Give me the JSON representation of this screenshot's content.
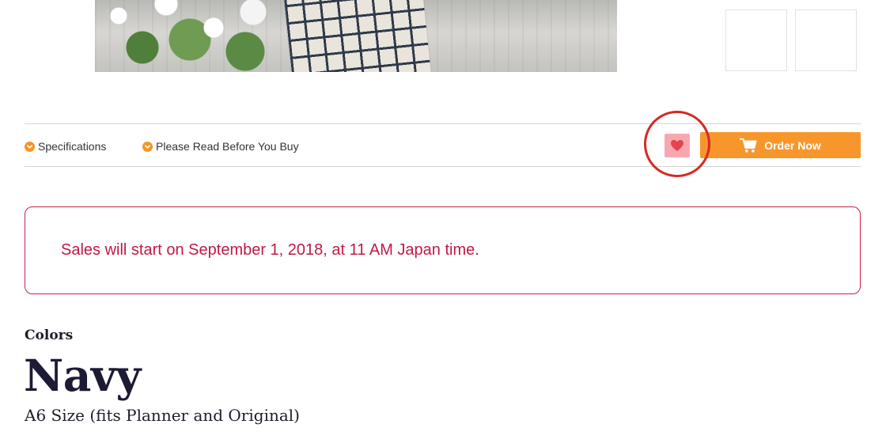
{
  "tabs": [
    {
      "label": "Specifications",
      "icon": "chevron-down-icon"
    },
    {
      "label": "Please Read Before You Buy",
      "icon": "chevron-down-icon"
    }
  ],
  "actions": {
    "favorite_icon": "heart-icon",
    "order_label": "Order Now",
    "order_icon": "cart-icon"
  },
  "notice": {
    "text": "Sales will start on September 1, 2018, at 11 AM Japan time."
  },
  "product": {
    "colors_label": "Colors",
    "color_name": "Navy",
    "size_text": "A6 Size (fits Planner and Original)"
  },
  "colors": {
    "accent_orange": "#f7962b",
    "heart_bg": "#f7a8ae",
    "heart": "#e2454f",
    "notice_red": "#c21845",
    "highlight_ring": "#d32a23",
    "heading_navy": "#1c1b33"
  }
}
